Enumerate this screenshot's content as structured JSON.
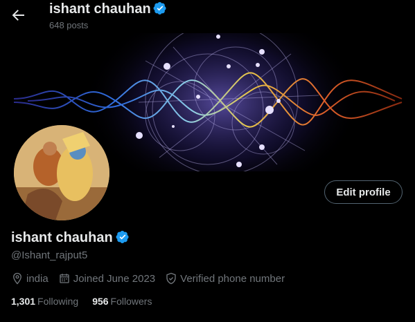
{
  "header": {
    "display_name": "ishant chauhan",
    "posts_count": "648 posts"
  },
  "profile": {
    "display_name": "ishant chauhan",
    "handle": "@Ishant_rajput5",
    "location": "india",
    "joined": "Joined June 2023",
    "verified_phone": "Verified phone number",
    "following_count": "1,301",
    "following_label": "Following",
    "followers_count": "956",
    "followers_label": "Followers"
  },
  "actions": {
    "edit_profile_label": "Edit profile"
  },
  "colors": {
    "verified_badge": "#1d9bf0",
    "background": "#000000",
    "secondary_text": "#71767b"
  },
  "icons": {
    "back": "arrow-left-icon",
    "verified": "verified-badge-icon",
    "location": "location-pin-icon",
    "calendar": "calendar-icon",
    "shield": "shield-check-icon"
  }
}
